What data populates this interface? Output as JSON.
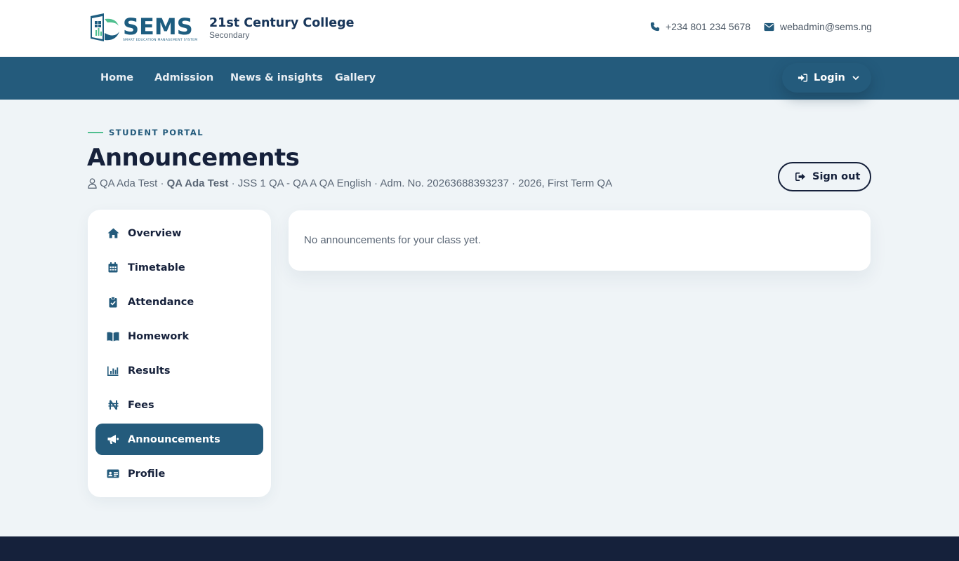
{
  "brand": {
    "logo_word": "SEMS",
    "logo_tagline": "SMART EDUCATION MANAGEMENT SYSTEM",
    "school_name": "21st Century College",
    "school_type": "Secondary"
  },
  "contact": {
    "phone": "+234 801 234 5678",
    "email": "webadmin@sems.ng"
  },
  "nav": {
    "items": [
      {
        "label": "Home"
      },
      {
        "label": "Admission"
      },
      {
        "label": "News & insights"
      },
      {
        "label": "Gallery"
      }
    ],
    "login_label": "Login"
  },
  "header": {
    "eyebrow": "STUDENT PORTAL",
    "title": "Announcements",
    "meta": {
      "username": "QA Ada Test",
      "sep1": " · ",
      "full_name": "QA Ada Test",
      "rest": " · JSS 1 QA - QA A QA English · Adm. No. 20263688393237 · 2026, First Term QA"
    },
    "signout_label": "Sign out"
  },
  "sidebar": {
    "items": [
      {
        "label": "Overview",
        "icon": "home-icon"
      },
      {
        "label": "Timetable",
        "icon": "calendar-icon"
      },
      {
        "label": "Attendance",
        "icon": "clipboard-check-icon"
      },
      {
        "label": "Homework",
        "icon": "book-open-icon"
      },
      {
        "label": "Results",
        "icon": "chart-bar-icon"
      },
      {
        "label": "Fees",
        "icon": "naira-icon"
      },
      {
        "label": "Announcements",
        "icon": "megaphone-icon",
        "active": true
      },
      {
        "label": "Profile",
        "icon": "id-card-icon"
      }
    ]
  },
  "main": {
    "empty_message": "No announcements for your class yet."
  },
  "colors": {
    "primary": "#245b7c",
    "dark": "#16213b",
    "accent": "#4fbf8f",
    "background": "#eff4f7"
  }
}
